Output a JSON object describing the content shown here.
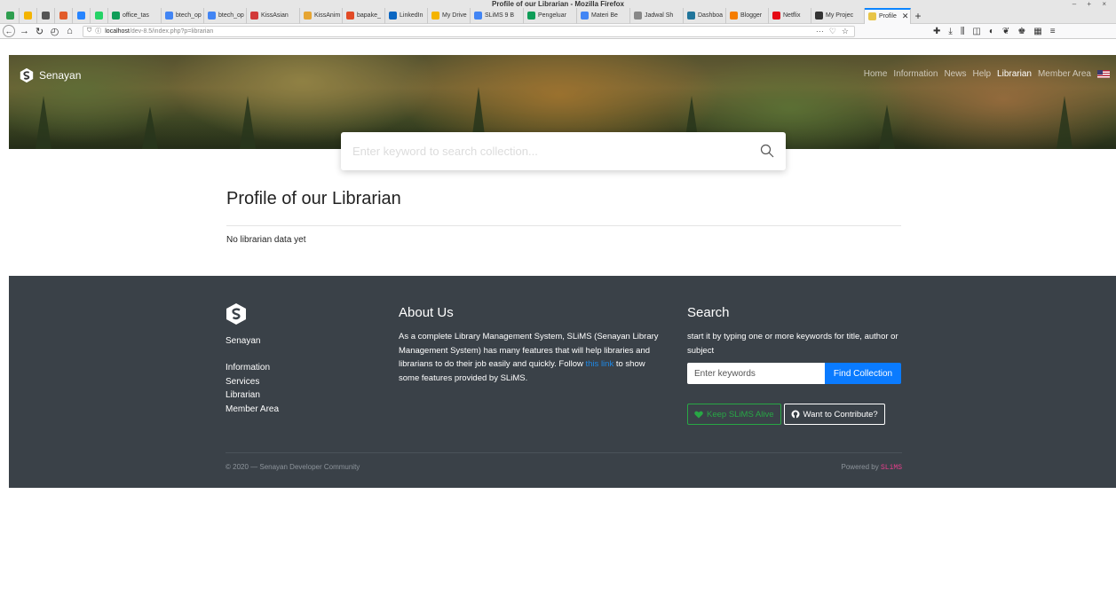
{
  "window": {
    "title": "Profile of our Librarian - Mozilla Firefox",
    "controls": "– + ×"
  },
  "tabs": [
    {
      "label": "",
      "pinned": true,
      "color": "#2e9e4f"
    },
    {
      "label": "",
      "pinned": true,
      "color": "#f4b400"
    },
    {
      "label": "",
      "pinned": true,
      "color": "#555555"
    },
    {
      "label": "",
      "pinned": true,
      "color": "#e25c2b"
    },
    {
      "label": "",
      "pinned": true,
      "color": "#2684ff"
    },
    {
      "label": "",
      "pinned": true,
      "color": "#25d366"
    },
    {
      "label": "office_tas",
      "color": "#0f9d58"
    },
    {
      "label": "btech_op",
      "color": "#4285f4"
    },
    {
      "label": "btech_op",
      "color": "#4285f4"
    },
    {
      "label": "KissAsian",
      "color": "#d23a3a"
    },
    {
      "label": "KissAnim",
      "color": "#e6a532"
    },
    {
      "label": "bapake_",
      "color": "#e24b26"
    },
    {
      "label": "LinkedIn",
      "color": "#0a66c2"
    },
    {
      "label": "My Drive",
      "color": "#f4b400"
    },
    {
      "label": "SLiMS 9 B",
      "color": "#4285f4"
    },
    {
      "label": "Pengeluar",
      "color": "#0f9d58"
    },
    {
      "label": "Materi Be",
      "color": "#4285f4"
    },
    {
      "label": "Jadwal Sh",
      "color": "#888888"
    },
    {
      "label": "Dashboa",
      "color": "#21759b"
    },
    {
      "label": "Blogger",
      "color": "#f57d00"
    },
    {
      "label": "Netflix",
      "color": "#e50914"
    },
    {
      "label": "My Projec",
      "color": "#333333"
    },
    {
      "label": "Profile",
      "color": "#e8c547",
      "active": true
    }
  ],
  "tab_close": "✕",
  "new_tab": "+",
  "address": {
    "host": "localhost",
    "path": "/dev-8.5/index.php?p=librarian",
    "more": "···"
  },
  "site": {
    "brand": "Senayan",
    "nav": [
      "Home",
      "Information",
      "News",
      "Help",
      "Librarian",
      "Member Area"
    ],
    "active_nav": "Librarian",
    "search_placeholder": "Enter keyword to search collection..."
  },
  "content": {
    "heading": "Profile of our Librarian",
    "message": "No librarian data yet"
  },
  "footer": {
    "brand": "Senayan",
    "links": [
      "Information",
      "Services",
      "Librarian",
      "Member Area"
    ],
    "about_title": "About Us",
    "about_text_before": "As a complete Library Management System, SLiMS (Senayan Library Management System) has many features that will help libraries and librarians to do their job easily and quickly. Follow ",
    "about_link": "this link",
    "about_text_after": " to show some features provided by SLiMS.",
    "search_title": "Search",
    "search_text": "start it by typing one or more keywords for title, author or subject",
    "search_placeholder": "Enter keywords",
    "search_button": "Find Collection",
    "alive_button": "Keep SLiMS Alive",
    "contribute_button": "Want to Contribute?",
    "copyright": "© 2020 — Senayan Developer Community",
    "powered_by": "Powered by",
    "powered_brand": "SLiMS"
  }
}
